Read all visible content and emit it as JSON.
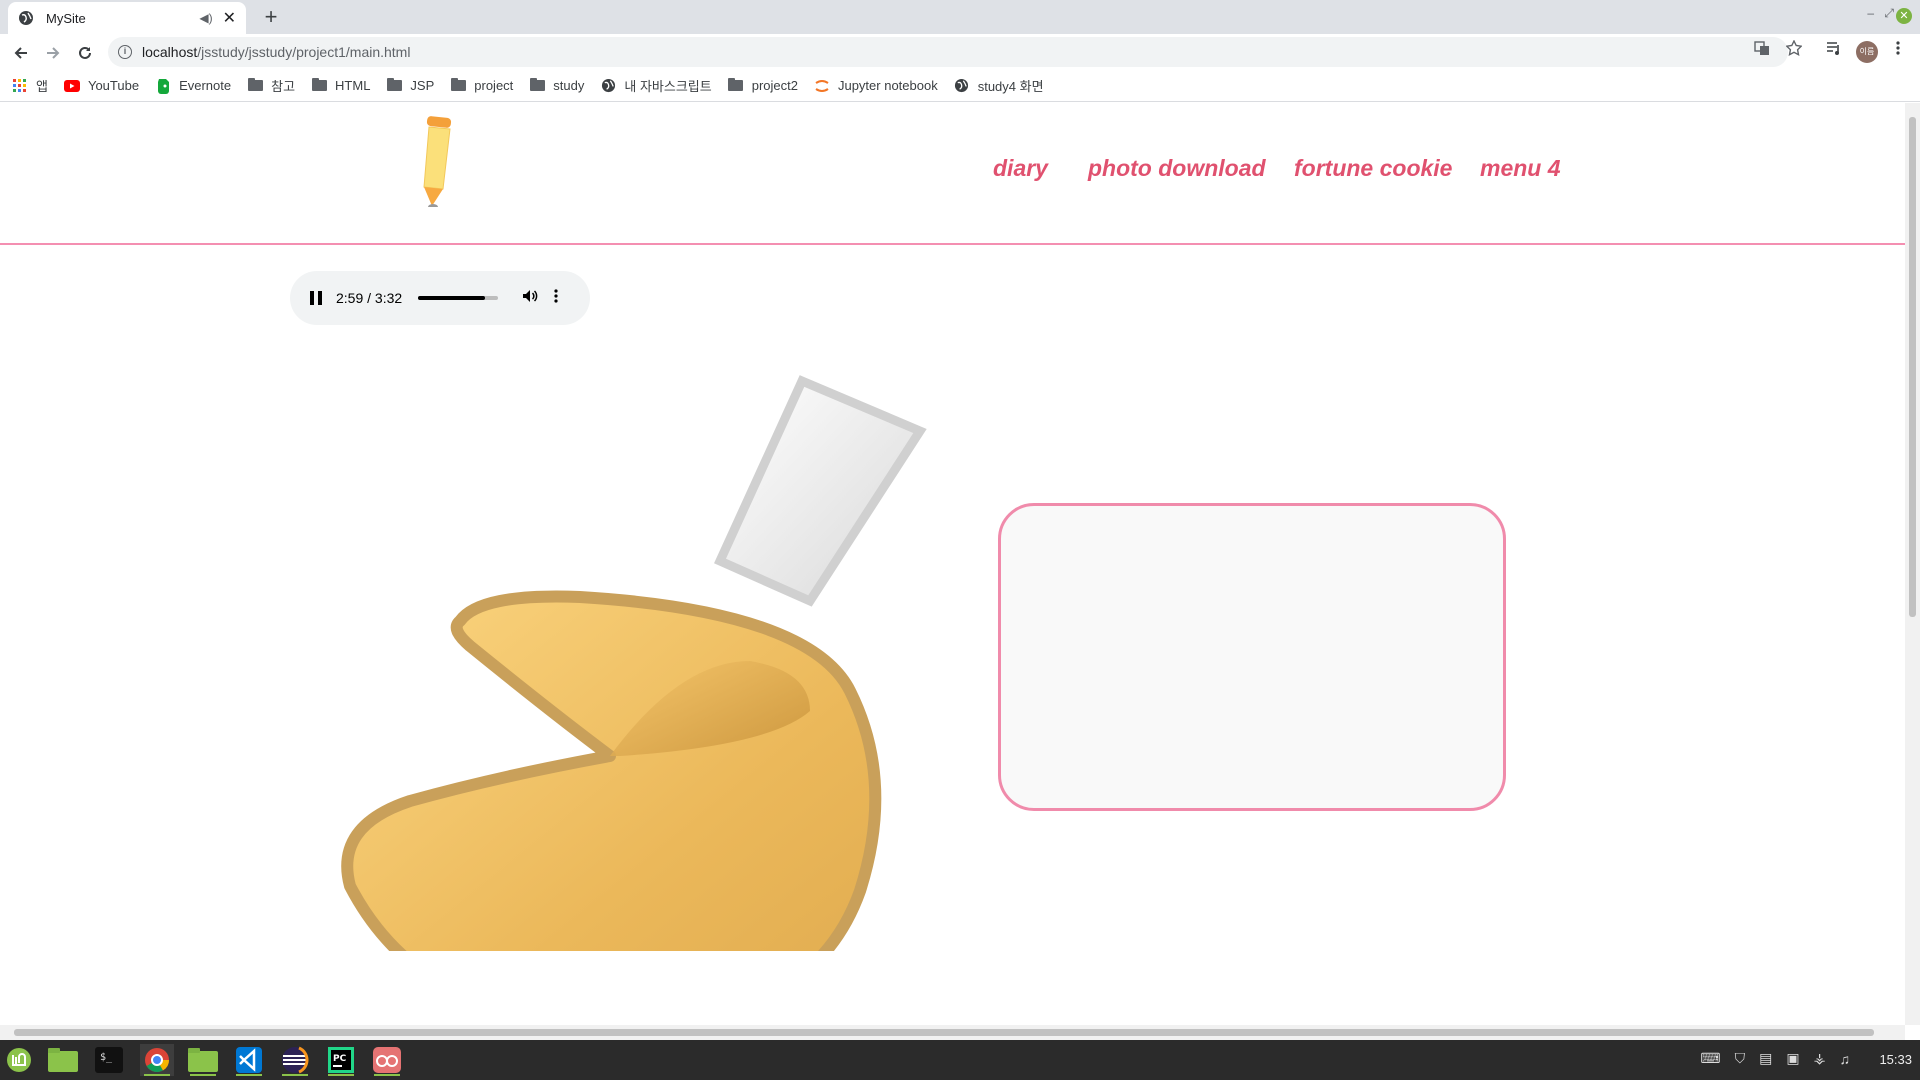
{
  "browser": {
    "tab_title": "MySite",
    "url_host": "localhost",
    "url_path": "/jsstudy/jsstudy/project1/main.html",
    "profile_label": "이름"
  },
  "bookmarks": [
    {
      "label": "앱",
      "icon": "apps-grid-icon"
    },
    {
      "label": "YouTube",
      "icon": "youtube-icon"
    },
    {
      "label": "Evernote",
      "icon": "evernote-icon"
    },
    {
      "label": "참고",
      "icon": "folder-icon"
    },
    {
      "label": "HTML",
      "icon": "folder-icon"
    },
    {
      "label": "JSP",
      "icon": "folder-icon"
    },
    {
      "label": "project",
      "icon": "folder-icon"
    },
    {
      "label": "study",
      "icon": "folder-icon"
    },
    {
      "label": "내 자바스크립트",
      "icon": "globe-icon"
    },
    {
      "label": "project2",
      "icon": "folder-icon"
    },
    {
      "label": "Jupyter notebook",
      "icon": "jupyter-icon"
    },
    {
      "label": "study4 화면",
      "icon": "globe-icon"
    }
  ],
  "site": {
    "menu": [
      "diary",
      "photo download",
      "fortune cookie",
      "menu 4"
    ],
    "accent_color": "#e0516f"
  },
  "audio": {
    "time": "2:59 / 3:32",
    "progress": 0.84
  },
  "taskbar": {
    "clock": "15:33",
    "apps": [
      "mint-menu-icon",
      "files-icon",
      "terminal-icon",
      "chrome-icon",
      "files-icon",
      "vscode-icon",
      "eclipse-icon",
      "pycharm-icon",
      "viewer-icon"
    ]
  }
}
